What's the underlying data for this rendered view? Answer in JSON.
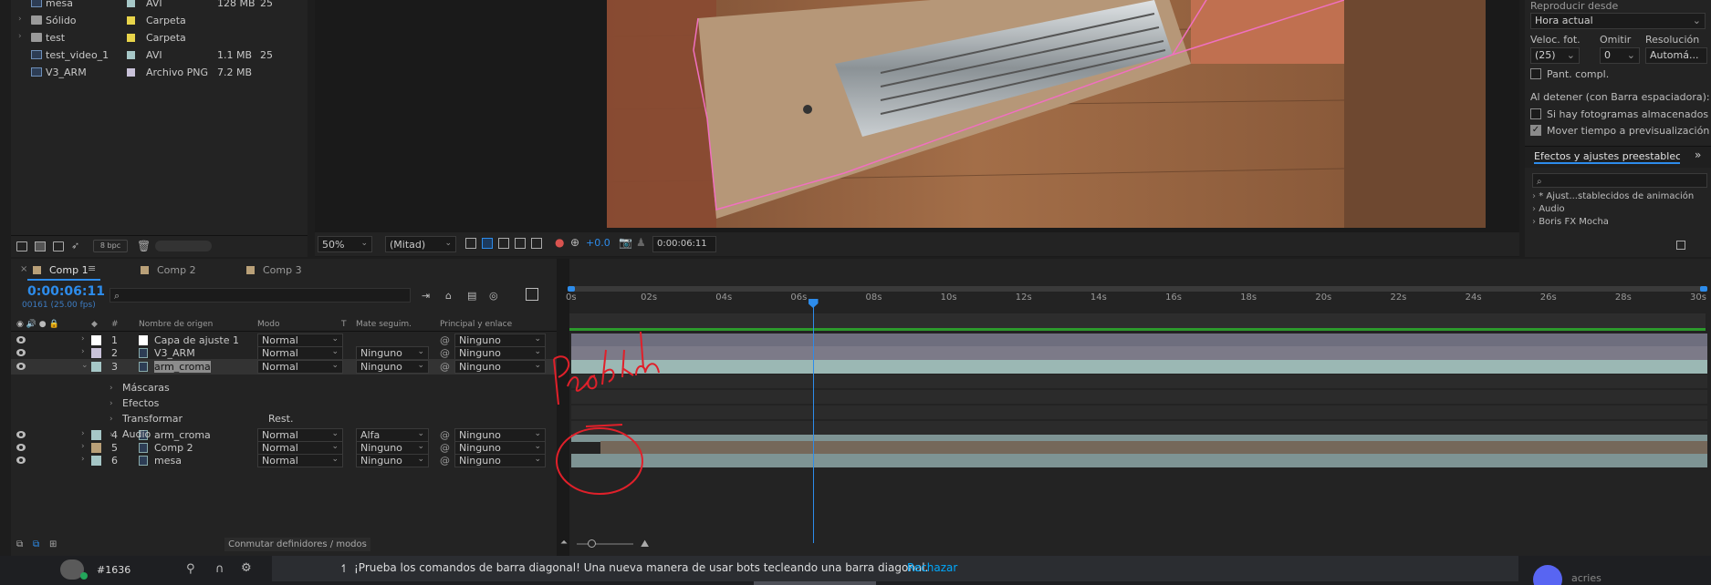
{
  "project": {
    "rows": [
      {
        "name": "mesa",
        "type": "AVI",
        "size": "128 MB",
        "fps": "25",
        "color": "#a6c7c7",
        "kind": "file"
      },
      {
        "name": "Sólido",
        "type": "Carpeta",
        "size": "",
        "fps": "",
        "color": "#e8d44a",
        "kind": "folder"
      },
      {
        "name": "test",
        "type": "Carpeta",
        "size": "",
        "fps": "",
        "color": "#e8d44a",
        "kind": "folder"
      },
      {
        "name": "test_video_1",
        "type": "AVI",
        "size": "1.1 MB",
        "fps": "25",
        "color": "#a6c7c7",
        "kind": "file"
      },
      {
        "name": "V3_ARM",
        "type": "Archivo PNG",
        "size": "7.2 MB",
        "fps": "",
        "color": "#c9c2d9",
        "kind": "file"
      }
    ],
    "bpc": "8 bpc"
  },
  "viewer": {
    "zoom": "50%",
    "resolution": "(Mitad)",
    "exposure": "+0.0",
    "timecode": "0:00:06:11"
  },
  "preview": {
    "header": "Reproducir desde",
    "play_from": "Hora actual",
    "fps_label": "Veloc. fot.",
    "skip_label": "Omitir",
    "res_label": "Resolución",
    "fps_value": "(25)",
    "skip_value": "0",
    "res_value": "Automá...",
    "fullscreen": "Pant. compl.",
    "on_stop": "Al detener (con Barra espaciadora):",
    "opt1": "Si hay fotogramas almacenados, repr",
    "opt2": "Mover tiempo a previsualización",
    "effects_title": "Efectos y ajustes preestablecid",
    "effects": [
      "* Ajust...stablecidos de animación",
      "Audio",
      "Boris FX Mocha"
    ]
  },
  "timeline": {
    "tabs": [
      "Comp 1",
      "Comp 2",
      "Comp 3"
    ],
    "tab_colors": [
      "#b9a078",
      "#b9a078",
      "#b9a078"
    ],
    "timecode": "0:00:06:11",
    "frames": "00161 (25.00 fps)",
    "headers": {
      "num": "#",
      "name": "Nombre de origen",
      "mode": "Modo",
      "t": "T",
      "matte": "Mate seguim.",
      "parent": "Principal y enlace"
    },
    "layers": [
      {
        "n": "1",
        "name": "Capa de ajuste 1",
        "mode": "Normal",
        "matte": "",
        "parent": "Ninguno",
        "color": "#ffffff"
      },
      {
        "n": "2",
        "name": "V3_ARM",
        "mode": "Normal",
        "matte": "Ninguno",
        "parent": "Ninguno",
        "color": "#c9c2d9"
      },
      {
        "n": "3",
        "name": "arm_croma",
        "mode": "Normal",
        "matte": "Ninguno",
        "parent": "Ninguno",
        "color": "#a6c7c7"
      },
      {
        "n": "4",
        "name": "arm_croma",
        "mode": "Normal",
        "matte": "Alfa",
        "parent": "Ninguno",
        "color": "#a6c7c7"
      },
      {
        "n": "5",
        "name": "Comp 2",
        "mode": "Normal",
        "matte": "Ninguno",
        "parent": "Ninguno",
        "color": "#b9a078"
      },
      {
        "n": "6",
        "name": "mesa",
        "mode": "Normal",
        "matte": "Ninguno",
        "parent": "Ninguno",
        "color": "#a6c7c7"
      }
    ],
    "props": [
      "Máscaras",
      "Efectos",
      "Transformar",
      "Audio"
    ],
    "reset": "Rest.",
    "ruler": [
      "0s",
      "02s",
      "04s",
      "06s",
      "08s",
      "10s",
      "12s",
      "14s",
      "16s",
      "18s",
      "20s",
      "22s",
      "24s",
      "26s",
      "28s",
      "30s"
    ],
    "playhead_fraction": 0.2147,
    "toggle_label": "Conmutar definidores / modos",
    "annotation": "Problem"
  },
  "discord": {
    "channel": "#1636",
    "message": "¡Prueba los comandos de barra diagonal! Una nueva manera de usar bots tecleando una barra diagonal.",
    "dismiss": "Rechazar",
    "user": "acries"
  }
}
